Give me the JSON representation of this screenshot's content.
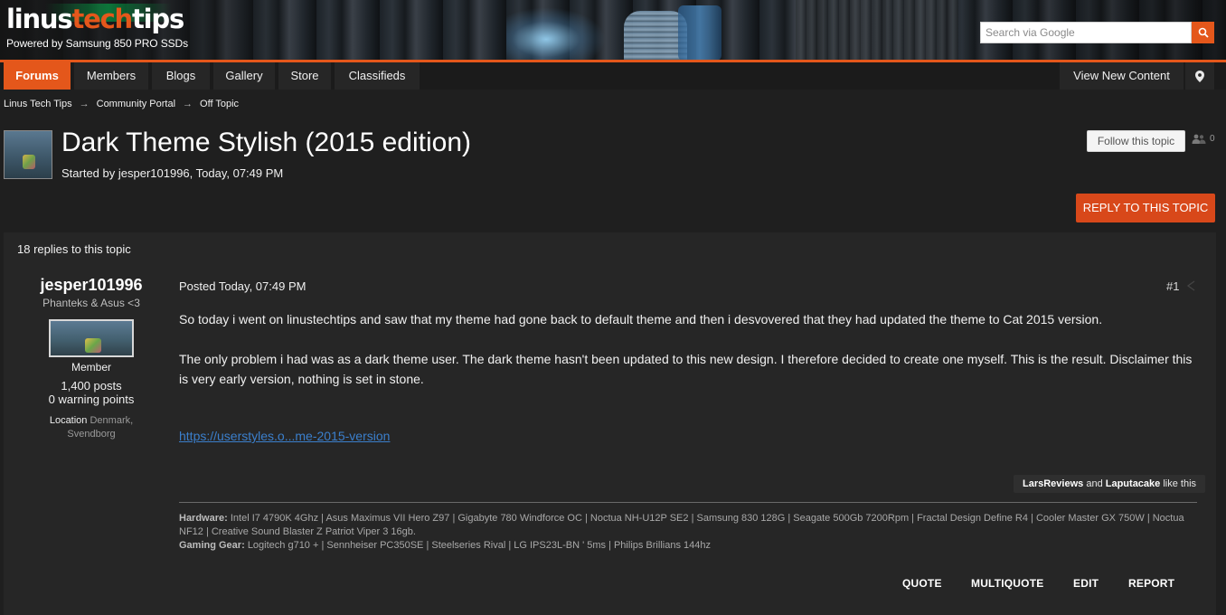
{
  "header": {
    "logo_part1": "linus",
    "logo_accent": "tech",
    "logo_part2": "tips",
    "tagline": "Powered by Samsung 850 PRO SSDs",
    "search_placeholder": "Search via Google",
    "search_icon": "search-icon"
  },
  "nav": {
    "items": [
      {
        "label": "Forums",
        "active": true
      },
      {
        "label": "Members",
        "active": false
      },
      {
        "label": "Blogs",
        "active": false
      },
      {
        "label": "Gallery",
        "active": false
      },
      {
        "label": "Store",
        "active": false
      },
      {
        "label": "Classifieds",
        "active": false
      }
    ],
    "view_new_content": "View New Content",
    "location_icon": "map-marker-icon"
  },
  "breadcrumb": {
    "items": [
      "Linus Tech Tips",
      "Community Portal",
      "Off Topic"
    ],
    "separator": "→"
  },
  "topic": {
    "title": "Dark Theme Stylish (2015 edition)",
    "meta": "Started by jesper101996, Today, 07:49 PM",
    "follow_label": "Follow this topic",
    "followers_count": "0",
    "reply_label": "REPLY TO THIS TOPIC",
    "replies_count": "18 replies to this topic"
  },
  "post": {
    "author": {
      "name": "jesper101996",
      "title": "Phanteks & Asus <3",
      "group": "Member",
      "posts": "1,400 posts",
      "warnings": "0 warning points",
      "location_label": "Location",
      "location_value": "Denmark, Svendborg"
    },
    "posted": "Posted Today, 07:49 PM",
    "number": "#1",
    "paragraphs": [
      "So today i went on linustechtips and saw that my theme had gone back to default theme and then i desvovered that they had updated the theme to Cat 2015 version.",
      "The only problem i had was as a dark theme user. The dark theme hasn't been updated to this new design. I therefore decided to create one myself. This is the result. Disclaimer this is very early version, nothing is set in stone."
    ],
    "link": "https://userstyles.o...me-2015-version",
    "likes": {
      "user1": "LarsReviews",
      "and": "and",
      "user2": "Laputacake",
      "suffix": "like this"
    },
    "signature": {
      "hardware_label": "Hardware:",
      "hardware": "Intel I7 4790K 4Ghz | Asus Maximus VII Hero Z97 | Gigabyte 780 Windforce OC | Noctua NH-U12P SE2 | Samsung 830 128G | Seagate 500Gb 7200Rpm | Fractal Design Define R4 | Cooler Master GX 750W | Noctua NF12 | Creative Sound Blaster Z Patriot Viper 3 16gb.",
      "gaming_label": "Gaming Gear:",
      "gaming": "Logitech g710 + | Sennheiser PC350SE | Steelseries Rival | LG IPS23L-BN ' 5ms | Philips Brillians 144hz"
    },
    "actions": [
      "QUOTE",
      "MULTIQUOTE",
      "EDIT",
      "REPORT"
    ]
  },
  "colors": {
    "accent": "#e4571b",
    "background": "#1f1f1f",
    "panel": "#262626",
    "link": "#3b7fcc"
  }
}
